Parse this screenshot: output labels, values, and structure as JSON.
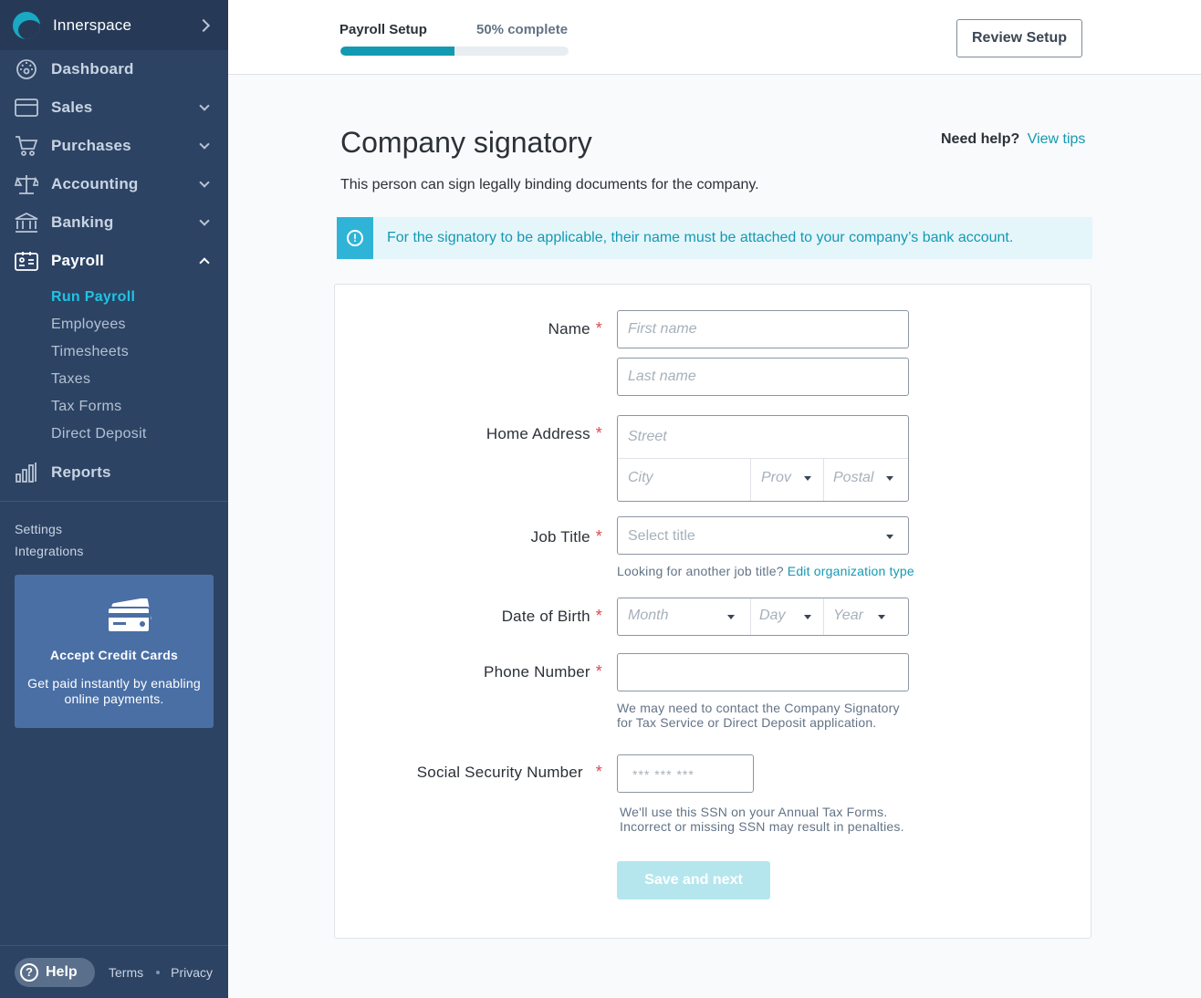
{
  "brand": {
    "name": "Innerspace"
  },
  "nav": {
    "dashboard": "Dashboard",
    "sales": "Sales",
    "purchases": "Purchases",
    "accounting": "Accounting",
    "banking": "Banking",
    "payroll": "Payroll",
    "reports": "Reports"
  },
  "payroll_sub": [
    "Run Payroll",
    "Employees",
    "Timesheets",
    "Taxes",
    "Tax Forms",
    "Direct Deposit"
  ],
  "small_links": {
    "settings": "Settings",
    "integrations": "Integrations"
  },
  "promo": {
    "title": "Accept Credit Cards",
    "text": "Get paid instantly by enabling online payments."
  },
  "footer": {
    "help": "Help",
    "terms": "Terms",
    "privacy": "Privacy"
  },
  "progress": {
    "label": "Payroll Setup",
    "percent_label": "50% complete",
    "value": 0.5
  },
  "review_button": "Review Setup",
  "page": {
    "title": "Company signatory",
    "subtitle": "This person can sign legally binding documents for the company.",
    "help_question": "Need help?",
    "help_link": "View tips"
  },
  "notice": "For the signatory to be applicable, their name must be attached to your company’s bank account.",
  "form": {
    "name_label": "Name",
    "first_name_ph": "First name",
    "last_name_ph": "Last name",
    "address_label": "Home Address",
    "street_ph": "Street",
    "city_ph": "City",
    "prov_ph": "Prov",
    "postal_ph": "Postal",
    "job_label": "Job Title",
    "job_ph": "Select title",
    "job_hint": "Looking for another job title?",
    "job_hint_link": "Edit organization type",
    "dob_label": "Date of Birth",
    "month_ph": "Month",
    "day_ph": "Day",
    "year_ph": "Year",
    "phone_label": "Phone Number",
    "phone_hint_1": "We may need to contact the Company Signatory",
    "phone_hint_2": "for Tax Service or Direct Deposit application.",
    "ssn_label": "Social Security Number",
    "ssn_ph": "*** *** ***",
    "ssn_hint_1": "We'll use this SSN on your Annual Tax Forms.",
    "ssn_hint_2": "Incorrect or missing SSN may result in penalties.",
    "required_mark": "*",
    "save_button": "Save and next"
  },
  "colors": {
    "sidebar": "#2c4364",
    "accent": "#1499b2",
    "active_sub": "#1fc3e3",
    "required": "#e0484d"
  }
}
